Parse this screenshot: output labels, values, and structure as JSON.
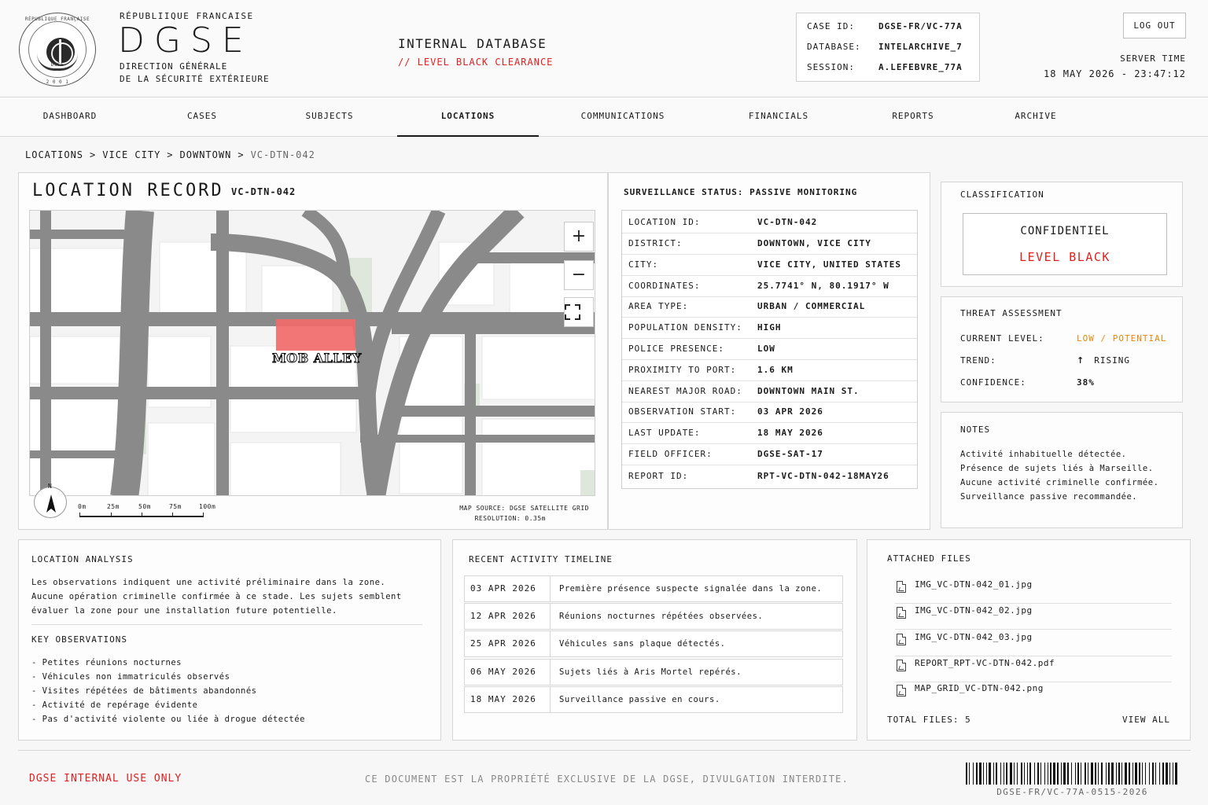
{
  "header": {
    "seal_top_text": "RÉPUBLIQUE FRANÇAISE",
    "seal_bottom_text": "DGSE",
    "seal_year": "2 0 0 1",
    "republic": "RÉPUBLIIQUE FRANCAISE",
    "brand": "DGSE",
    "direction_line1": "DIRECTION GÉNÉRALE",
    "direction_line2": "DE LA SÉCURITÉ EXTÉRIEURE",
    "database_title": "INTERNAL DATABASE",
    "clearance": "// LEVEL BLACK CLEARANCE",
    "case": {
      "case_label": "CASE ID:",
      "case_value": "DGSE-FR/VC-77A",
      "db_label": "DATABASE:",
      "db_value": "INTELARCHIVE_7",
      "session_label": "SESSION:",
      "session_value": "A.LEFEBVRE_77A"
    },
    "logout": "LOG OUT",
    "server_time_label": "SERVER TIME",
    "server_time_value": "18 MAY 2026 - 23:47:12"
  },
  "nav": {
    "tabs": [
      "DASHBOARD",
      "CASES",
      "SUBJECTS",
      "LOCATIONS",
      "COMMUNICATIONS",
      "FINANCIALS",
      "REPORTS",
      "ARCHIVE"
    ],
    "active": "LOCATIONS"
  },
  "breadcrumb": [
    "LOCATIONS",
    "VICE CITY",
    "DOWNTOWN",
    "VC-DTN-042"
  ],
  "breadcrumb_sep": ">",
  "record": {
    "title": "LOCATION RECORD",
    "id": "VC-DTN-042",
    "map": {
      "zoom_in": "+",
      "zoom_out": "−",
      "marker_label": "MOB ALLEY",
      "north": "N",
      "scale_labels": [
        "0m",
        "25m",
        "50m",
        "75m",
        "100m"
      ],
      "source_line1": "MAP SOURCE: DGSE SATELLITE GRID",
      "source_line2": "RESOLUTION: 0.35m"
    }
  },
  "surveillance": {
    "title": "SURVEILLANCE STATUS: PASSIVE MONITORING",
    "rows": [
      {
        "k": "LOCATION ID:",
        "v": "VC-DTN-042"
      },
      {
        "k": "DISTRICT:",
        "v": "DOWNTOWN, VICE CITY"
      },
      {
        "k": "CITY:",
        "v": "VICE CITY, UNITED STATES"
      },
      {
        "k": "COORDINATES:",
        "v": "25.7741° N, 80.1917° W"
      },
      {
        "k": "AREA TYPE:",
        "v": "URBAN / COMMERCIAL"
      },
      {
        "k": "POPULATION DENSITY:",
        "v": "HIGH"
      },
      {
        "k": "POLICE PRESENCE:",
        "v": "LOW"
      },
      {
        "k": "PROXIMITY TO PORT:",
        "v": "1.6 KM"
      },
      {
        "k": "NEAREST MAJOR ROAD:",
        "v": "DOWNTOWN MAIN ST."
      },
      {
        "k": "OBSERVATION START:",
        "v": "03 APR 2026"
      },
      {
        "k": "LAST UPDATE:",
        "v": "18 MAY 2026"
      },
      {
        "k": "FIELD OFFICER:",
        "v": "DGSE-SAT-17"
      },
      {
        "k": "REPORT ID:",
        "v": "RPT-VC-DTN-042-18MAY26"
      }
    ]
  },
  "classification": {
    "title": "CLASSIFICATION",
    "confidentiel": "CONFIDENTIEL",
    "level": "LEVEL BLACK"
  },
  "threat": {
    "title": "THREAT ASSESSMENT",
    "current_label": "CURRENT LEVEL:",
    "current_value": "LOW / POTENTIAL",
    "trend_label": "TREND:",
    "trend_arrow": "↑",
    "trend_value": "RISING",
    "confidence_label": "CONFIDENCE:",
    "confidence_value": "38%"
  },
  "notes": {
    "title": "NOTES",
    "lines": [
      "Activité inhabituelle détectée.",
      "Présence de sujets liés à Marseille.",
      "Aucune activité criminelle confirmée.",
      "Surveillance passive recommandée."
    ]
  },
  "analysis": {
    "title": "LOCATION ANALYSIS",
    "lines": [
      "Les observations indiquent une activité préliminaire dans la zone.",
      "Aucune opération criminelle confirmée à ce stade. Les sujets semblent",
      "évaluer la zone pour une installation future potentielle."
    ],
    "obs_title": "KEY OBSERVATIONS",
    "observations": [
      "- Petites réunions nocturnes",
      "- Véhicules non immatriculés observés",
      "- Visites répétées de bâtiments abandonnés",
      "- Activité de repérage évidente",
      "- Pas d'activité violente ou liée à drogue détectée"
    ]
  },
  "timeline": {
    "title": "RECENT ACTIVITY TIMELINE",
    "items": [
      {
        "date": "03 APR 2026",
        "text": "Première présence suspecte signalée dans la zone."
      },
      {
        "date": "12 APR 2026",
        "text": "Réunions nocturnes répétées observées."
      },
      {
        "date": "25 APR 2026",
        "text": "Véhicules sans plaque détectés."
      },
      {
        "date": "06 MAY 2026",
        "text": "Sujets liés à Aris Mortel repérés."
      },
      {
        "date": "18 MAY 2026",
        "text": "Surveillance passive en cours."
      }
    ]
  },
  "files": {
    "title": "ATTACHED FILES",
    "items": [
      "IMG_VC-DTN-042_01.jpg",
      "IMG_VC-DTN-042_02.jpg",
      "IMG_VC-DTN-042_03.jpg",
      "REPORT_RPT-VC-DTN-042.pdf",
      "MAP_GRID_VC-DTN-042.png"
    ],
    "total": "TOTAL FILES: 5",
    "view_all": "VIEW ALL"
  },
  "footer": {
    "left": "DGSE INTERNAL USE ONLY",
    "middle": "CE DOCUMENT EST LA PROPRIÉTÉ EXCLUSIVE DE LA DGSE, DIVULGATION INTERDITE.",
    "barcode_text": "DGSE-FR/VC-77A-0515-2026"
  },
  "colors": {
    "accent_red": "#e01f1f",
    "warning_orange": "#e8870e",
    "marker_red": "#f26a6a",
    "road_gray": "#8a8a8a",
    "park_green": "#dfe6dc"
  }
}
